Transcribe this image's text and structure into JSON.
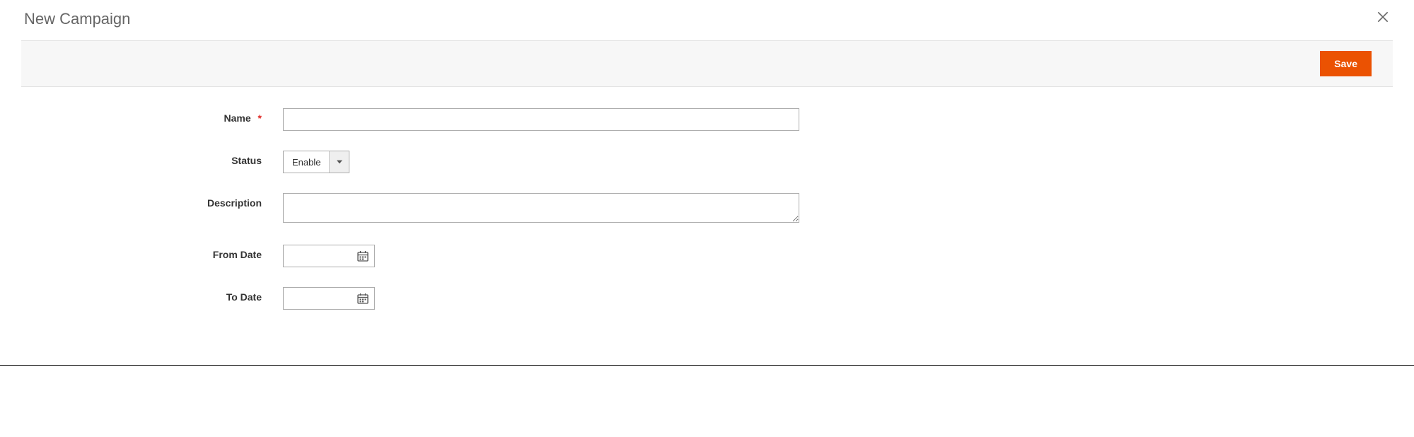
{
  "modal": {
    "title": "New Campaign"
  },
  "actions": {
    "save_label": "Save"
  },
  "form": {
    "name": {
      "label": "Name",
      "value": "",
      "required": true
    },
    "status": {
      "label": "Status",
      "value": "Enable"
    },
    "description": {
      "label": "Description",
      "value": ""
    },
    "from_date": {
      "label": "From Date",
      "value": ""
    },
    "to_date": {
      "label": "To Date",
      "value": ""
    }
  }
}
